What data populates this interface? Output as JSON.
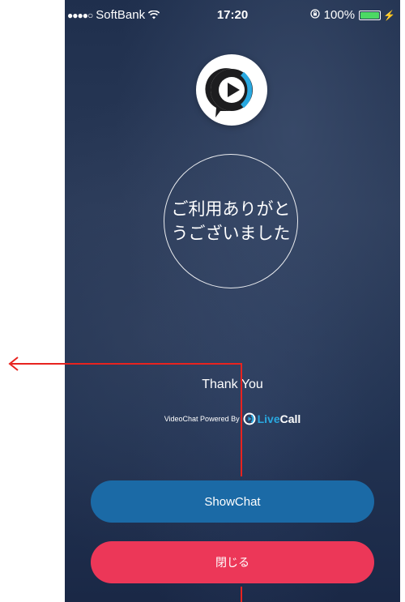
{
  "status_bar": {
    "signal": "●●●●○",
    "carrier": "SoftBank",
    "time": "17:20",
    "battery": "100%"
  },
  "app": {
    "message": "ご利用ありがとうございました",
    "thank_you": "Thank You",
    "powered_by": "VideoChat Powered By",
    "brand_part1": "Live",
    "brand_part2": "Call"
  },
  "buttons": {
    "show_chat": "ShowChat",
    "close": "閉じる"
  },
  "colors": {
    "show_chat_button": "#1b6aa6",
    "close_button": "#ec3758",
    "brand_accent": "#29a8e0",
    "annotation": "#e8231f"
  },
  "icons": {
    "wifi": "wifi-icon",
    "orientation_lock": "orientation-lock-icon",
    "battery": "battery-icon",
    "charging": "charging-icon",
    "app_logo": "play-chat-logo-icon",
    "annotation_arrow": "arrow-left-icon"
  }
}
